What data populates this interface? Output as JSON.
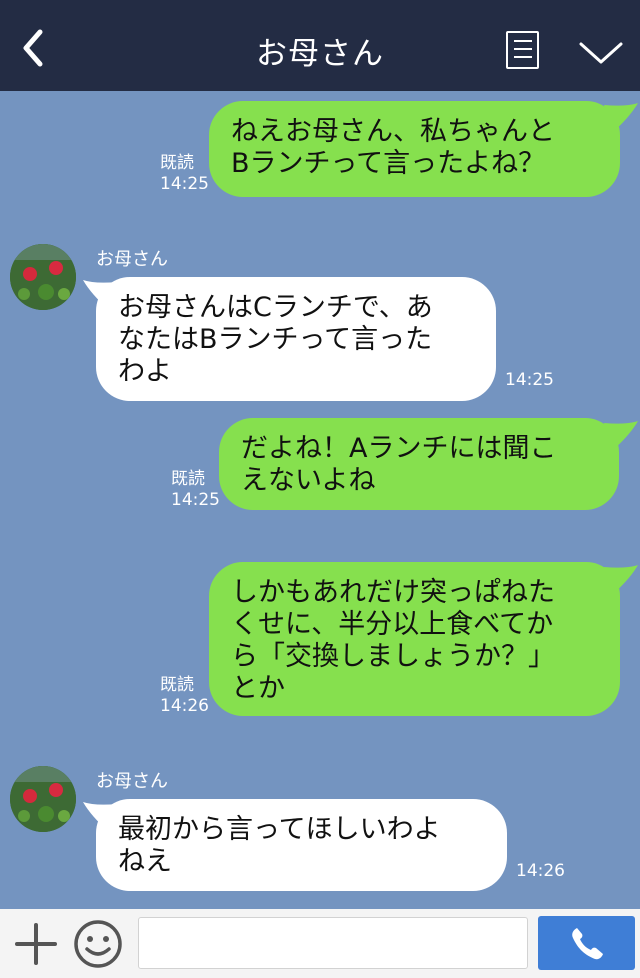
{
  "header": {
    "title": "お母さん",
    "back_icon": "chevron-left-icon",
    "menu_icon": "menu-icon",
    "collapse_icon": "chevron-down-icon"
  },
  "messages": [
    {
      "from": "me",
      "text": "ねえお母さん、私ちゃんと\nBランチって言ったよね？",
      "read": "既読",
      "time": "14:25"
    },
    {
      "from": "them",
      "sender": "お母さん",
      "text": "お母さんはCランチで、あ\nなたはBランチって言った\nわよ",
      "time": "14:25"
    },
    {
      "from": "me",
      "text": "だよね！Aランチには聞こ\nえないよね",
      "read": "既読",
      "time": "14:25"
    },
    {
      "from": "me",
      "text": "しかもあれだけ突っぱねた\nくせに、半分以上食べてか\nら「交換しましょうか？」\nとか",
      "read": "既読",
      "time": "14:26"
    },
    {
      "from": "them",
      "sender": "お母さん",
      "text": "最初から言ってほしいわよ\nねえ",
      "time": "14:26"
    }
  ],
  "input": {
    "value": "",
    "plus_icon": "plus-icon",
    "sticker_icon": "smiley-icon",
    "send_icon": "phone-icon"
  },
  "colors": {
    "header_bg": "#232c44",
    "chat_bg": "#7494c0",
    "my_bubble": "#86e04e",
    "their_bubble": "#ffffff",
    "send_button": "#3f7ed6"
  }
}
